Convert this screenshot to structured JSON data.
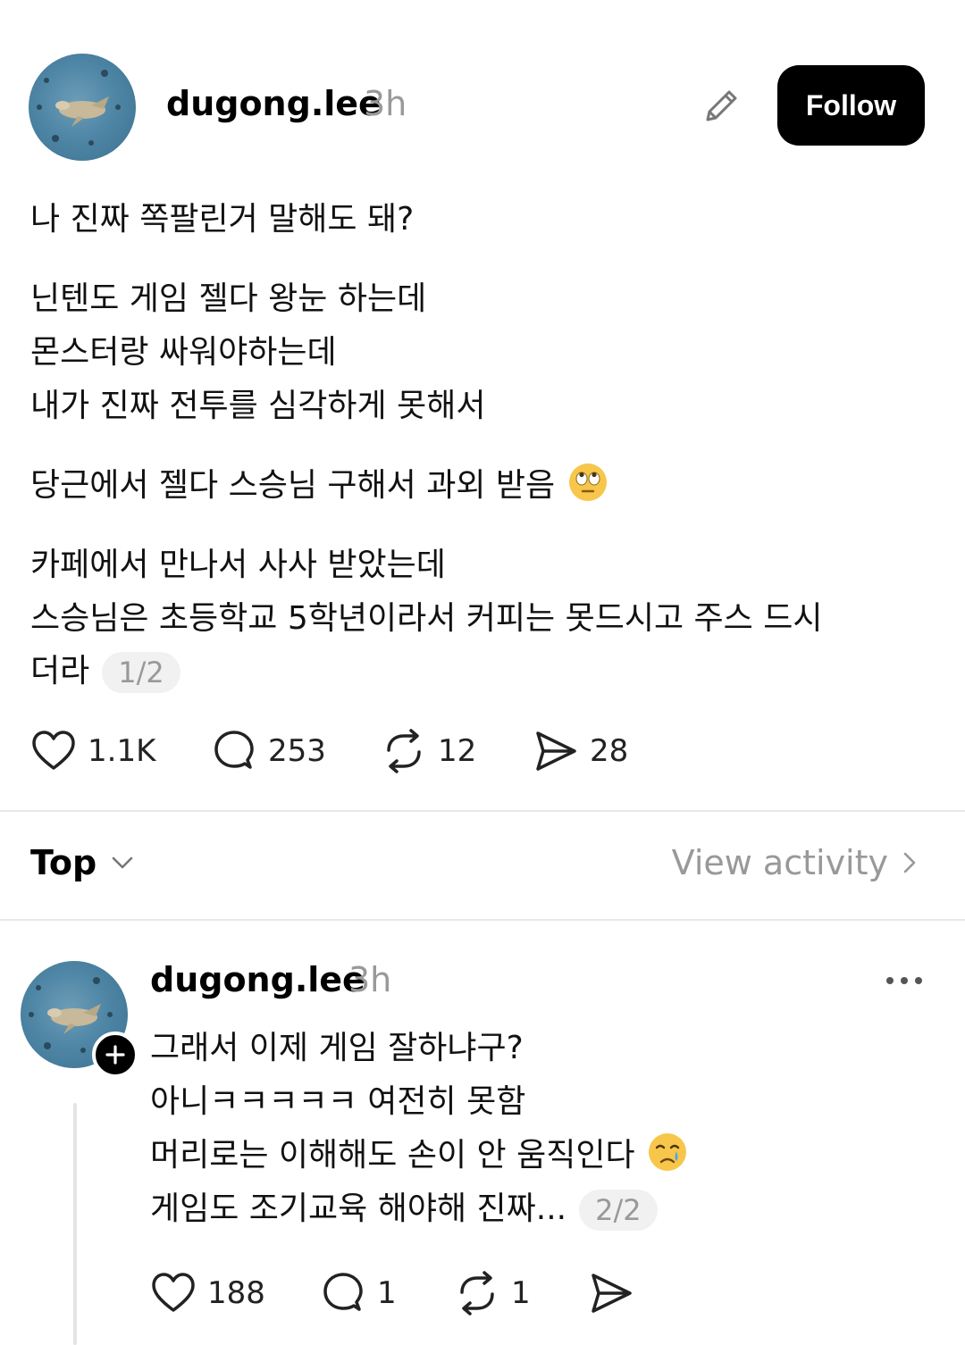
{
  "post": {
    "username": "dugong.lee",
    "time": "3h",
    "follow_label": "Follow",
    "lines": [
      "나 진짜 쪽팔린거 말해도 돼?",
      "닌텐도 게임 젤다 왕눈 하는데",
      "몬스터랑 싸워야하는데",
      "내가 진짜 전투를 심각하게 못해서",
      "당근에서 젤다 스승님 구해서 과외 받음",
      "카페에서 만나서 사사 받았는데",
      "스승님은 초등학교 5학년이라서 커피는 못드시고 주스 드시",
      "더라"
    ],
    "page_indicator": "1/2",
    "likes": "1.1K",
    "comments": "253",
    "reposts": "12",
    "shares": "28",
    "emoji_name": "face-with-rolling-eyes"
  },
  "sort": {
    "label": "Top",
    "view_activity": "View activity"
  },
  "reply": {
    "username": "dugong.lee",
    "time": "3h",
    "lines": [
      "그래서 이제 게임 잘하냐구?",
      "아니ㅋㅋㅋㅋㅋ 여전히 못함",
      "머리로는 이해해도 손이 안 움직인다",
      "게임도 조기교육 해야해 진짜..."
    ],
    "page_indicator": "2/2",
    "likes": "188",
    "comments": "1",
    "reposts": "1",
    "emoji_name": "crying-face"
  },
  "colors": {
    "accent": "#000000",
    "muted": "#999999",
    "divider": "#e8e8e8"
  }
}
